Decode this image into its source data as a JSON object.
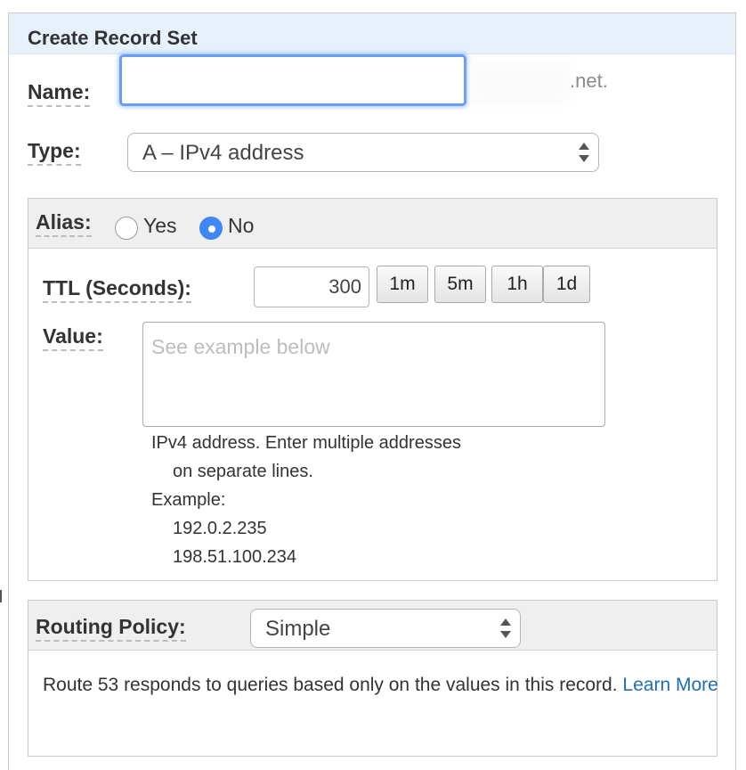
{
  "panel": {
    "title": "Create Record Set"
  },
  "name": {
    "label": "Name:",
    "value": "",
    "suffix": ".net."
  },
  "type": {
    "label": "Type:",
    "selected": "A – IPv4 address"
  },
  "alias": {
    "label": "Alias:",
    "options": [
      "Yes",
      "No"
    ],
    "selected": "No"
  },
  "ttl": {
    "label": "TTL (Seconds):",
    "value": "300",
    "buttons": [
      "1m",
      "5m",
      "1h",
      "1d"
    ]
  },
  "value": {
    "label": "Value:",
    "placeholder": "See example below",
    "help_line1": "IPv4 address. Enter multiple addresses",
    "help_line2": "on separate lines.",
    "example_label": "Example:",
    "examples": [
      "192.0.2.235",
      "198.51.100.234"
    ]
  },
  "routing": {
    "label": "Routing Policy:",
    "selected": "Simple",
    "description": "Route 53 responds to queries based only on the values in this record.",
    "link_text": "Learn More"
  },
  "colors": {
    "accent": "#3e87f5",
    "header_bg": "#e7f1fb",
    "link": "#1f6fb5"
  }
}
